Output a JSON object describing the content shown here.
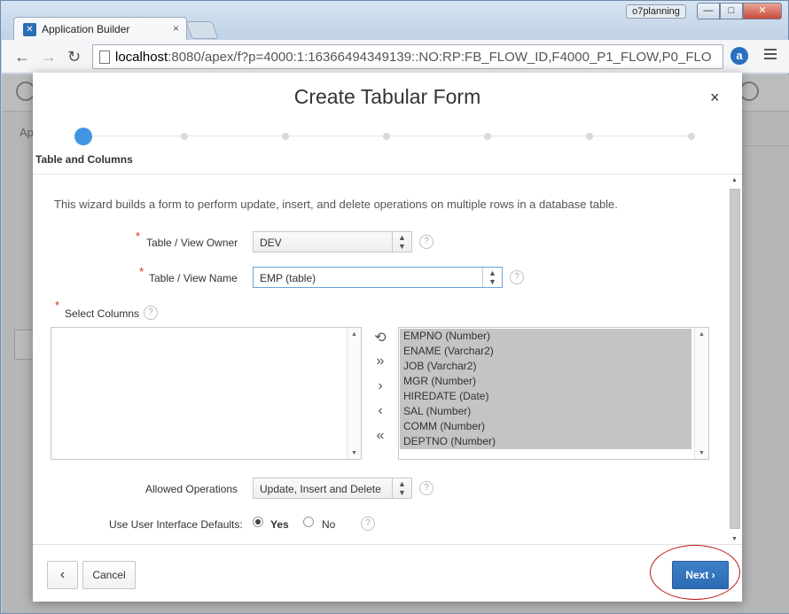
{
  "browser": {
    "tab_title": "Application Builder",
    "tab_close": "×",
    "user_badge": "o7planning",
    "win_min": "—",
    "win_max": "□",
    "win_close": "✕",
    "url_host": "localhost",
    "url_path": ":8080/apex/f?p=4000:1:16366494349139::NO:RP:FB_FLOW_ID,F4000_P1_FLOW,P0_FLO",
    "ext_icon": "a"
  },
  "background": {
    "text": "Ap"
  },
  "dialog": {
    "title": "Create Tabular Form",
    "close": "×",
    "steps": [
      "Table and Columns"
    ],
    "intro": "This wizard builds a form to perform update, insert, and delete operations on multiple rows in a database table.",
    "owner_label": "Table / View Owner",
    "owner_value": "DEV",
    "name_label": "Table / View Name",
    "name_value": "EMP (table)",
    "columns_label": "Select Columns",
    "selected_columns": [
      "EMPNO (Number)",
      "ENAME (Varchar2)",
      "JOB (Varchar2)",
      "MGR (Number)",
      "HIREDATE (Date)",
      "SAL (Number)",
      "COMM (Number)",
      "DEPTNO (Number)"
    ],
    "operations_label": "Allowed Operations",
    "operations_value": "Update, Insert and Delete",
    "ui_defaults_label": "Use User Interface Defaults:",
    "ui_defaults_yes": "Yes",
    "ui_defaults_no": "No",
    "ui_defaults_selected": "Yes",
    "help": "?",
    "required_mark": "*"
  },
  "footer": {
    "prev": "‹",
    "cancel": "Cancel",
    "next": "Next ›"
  },
  "colors": {
    "accent": "#4196e4",
    "primary_button": "#2f72ba",
    "required": "#e0261b",
    "highlight": "#c01717"
  }
}
